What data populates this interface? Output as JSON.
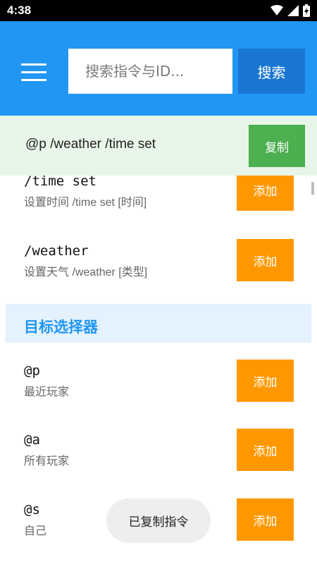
{
  "status_bar": {
    "time": "4:38"
  },
  "header": {
    "search": {
      "placeholder": "搜索指令与ID..."
    },
    "search_button": "搜索"
  },
  "copy_bar": {
    "command": "@p /weather /time set",
    "copy_button": "复制"
  },
  "list": {
    "items_top": [
      {
        "cmd": "/time set",
        "desc": "设置时间 /time set [时间]",
        "button": "添加"
      },
      {
        "cmd": "/weather",
        "desc": "设置天气 /weather [类型]",
        "button": "添加"
      }
    ],
    "section_title": "目标选择器",
    "items_bottom": [
      {
        "cmd": "@p",
        "desc": "最近玩家",
        "button": "添加"
      },
      {
        "cmd": "@a",
        "desc": "所有玩家",
        "button": "添加"
      },
      {
        "cmd": "@s",
        "desc": "自己",
        "button": "添加"
      }
    ]
  },
  "toast": "已复制指令",
  "colors": {
    "primary": "#2196f3",
    "primary_dark": "#1976d2",
    "copy_green": "#4caf50",
    "add_orange": "#ff9800",
    "copy_bar_bg": "#e8f5e9",
    "section_bg": "#e3f2fd"
  },
  "icons": [
    "wifi-icon",
    "signal-icon",
    "battery-charging-icon",
    "menu-icon"
  ]
}
